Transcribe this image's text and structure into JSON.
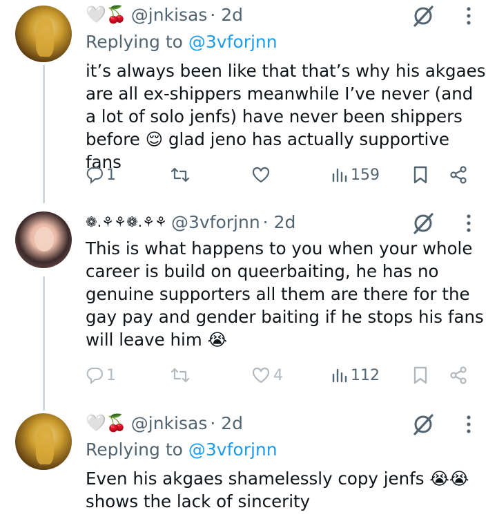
{
  "tweets": [
    {
      "emoji_prefix": "🤍🍒",
      "handle": "@jnkisas",
      "time": "· 2d",
      "replying_label": "Replying to",
      "replying_handle": "@3vforjnn",
      "text": "it’s always been like that that’s why his akgaes are all ex-shippers meanwhile I’ve never (and a lot of solo jenfs) have never been shippers before 😌 glad jeno has actually supportive fans",
      "replies": "1",
      "likes": "",
      "views": "159",
      "avatar_icon": "avatar-gold"
    },
    {
      "emoji_prefix": "❁.⚘⚘❁.⚘⚘",
      "handle": "@3vforjnn",
      "time": "· 2d",
      "text": "This is what happens to you when your whole career is build on queerbaiting, he has no genuine supporters all them are there for the gay pay and gender baiting if he stops his fans will leave him 😭",
      "replies": "1",
      "likes": "4",
      "views": "112",
      "avatar_icon": "avatar-girl"
    },
    {
      "emoji_prefix": "🤍🍒",
      "handle": "@jnkisas",
      "time": "· 2d",
      "replying_label": "Replying to",
      "replying_handle": "@3vforjnn",
      "text": "Even his akgaes shamelessly copy jenfs 😭😭 shows the lack of sincerity",
      "avatar_icon": "avatar-gold"
    }
  ],
  "icons": {
    "reply": "reply-icon",
    "retweet": "retweet-icon",
    "like": "heart-icon",
    "views": "views-icon",
    "bookmark": "bookmark-icon",
    "share": "share-icon",
    "grok": "grok-icon",
    "more": "more-icon"
  },
  "colors": {
    "link": "#1d9bf0",
    "muted": "#536471",
    "text": "#0f1419"
  }
}
